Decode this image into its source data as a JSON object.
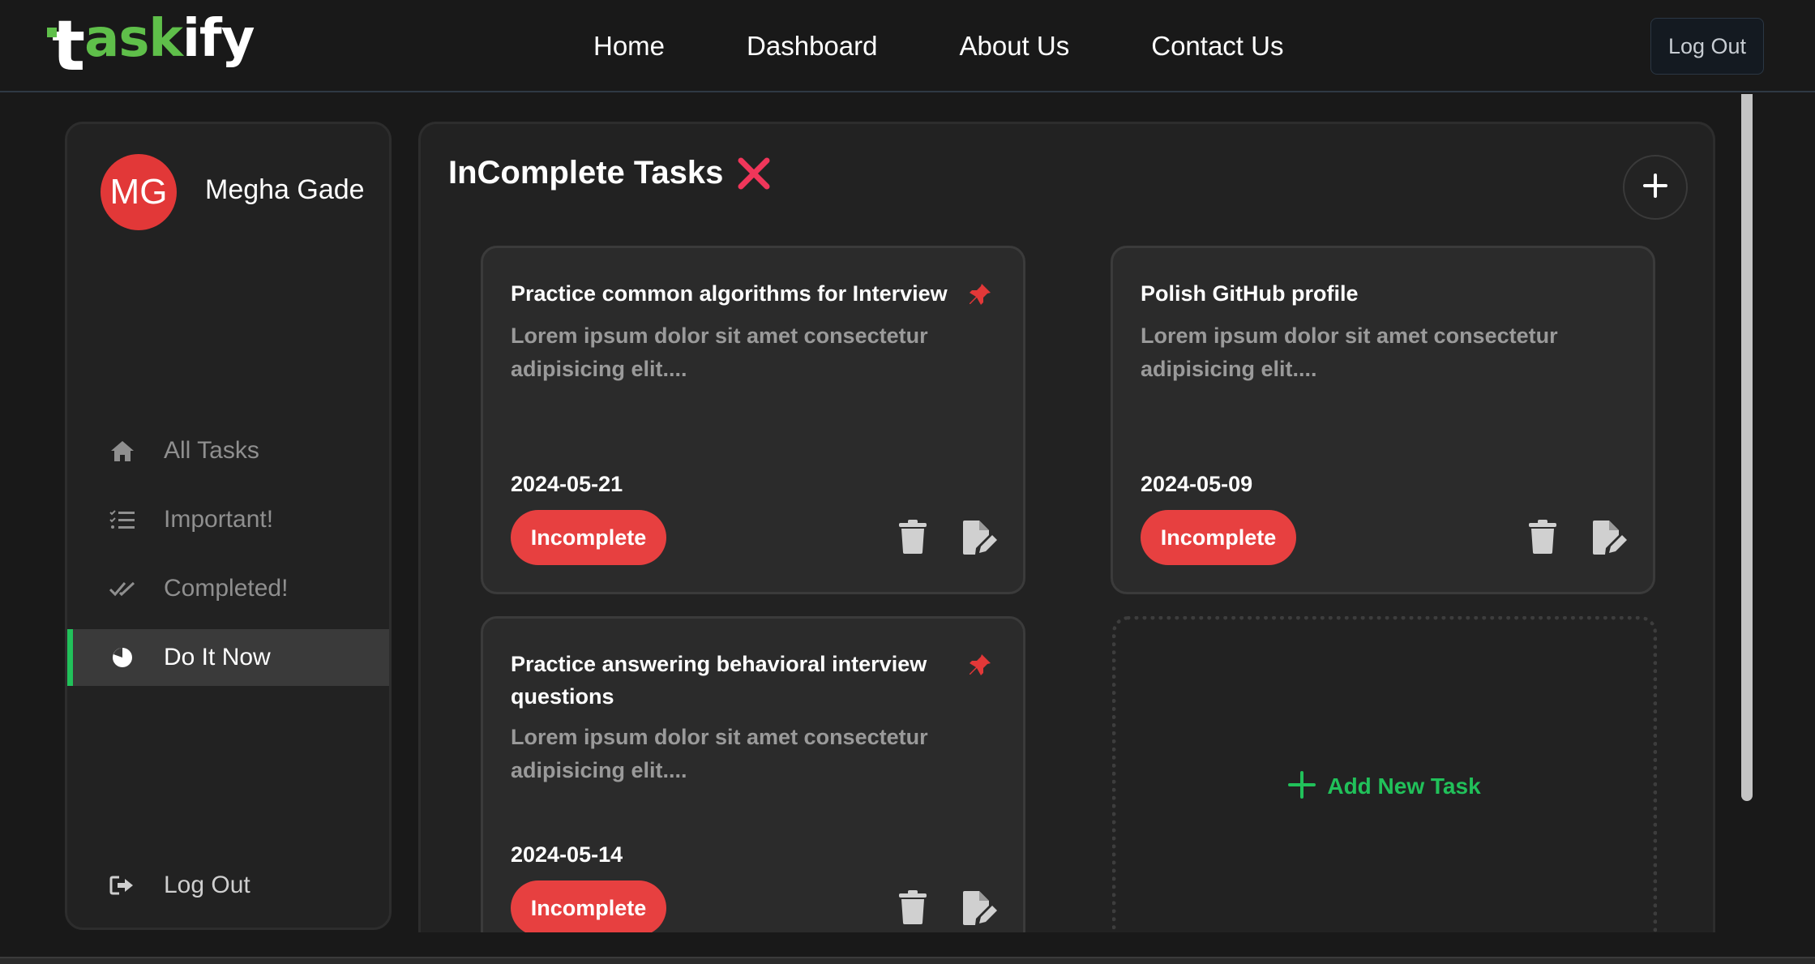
{
  "brand": {
    "logo_t": "t",
    "logo_ask": "ask",
    "logo_ify": "ify",
    "accent": "#5fbf4a"
  },
  "nav": {
    "links": [
      "Home",
      "Dashboard",
      "About Us",
      "Contact Us"
    ],
    "logout_label": "Log Out"
  },
  "sidebar": {
    "avatar_initials": "MG",
    "avatar_color": "#e23838",
    "user_name": "Megha Gade",
    "items": [
      {
        "label": "All Tasks",
        "icon": "home-icon"
      },
      {
        "label": "Important!",
        "icon": "list-check-icon"
      },
      {
        "label": "Completed!",
        "icon": "double-check-icon"
      },
      {
        "label": "Do It Now",
        "icon": "pie-chart-icon",
        "active": true
      }
    ],
    "logout_label": "Log Out",
    "active_color": "#21c15a"
  },
  "main": {
    "title": "InComplete Tasks",
    "title_icon": "x-icon",
    "add_button_icon": "plus-icon"
  },
  "tasks": [
    {
      "title": "Practice common algorithms for Interview",
      "description": "Lorem ipsum dolor sit amet consectetur adipisicing elit....",
      "date": "2024-05-21",
      "status": "Incomplete",
      "pinned": true
    },
    {
      "title": "Polish GitHub profile",
      "description": "Lorem ipsum dolor sit amet consectetur adipisicing elit....",
      "date": "2024-05-09",
      "status": "Incomplete",
      "pinned": false
    },
    {
      "title": "Practice answering behavioral interview questions",
      "description": "Lorem ipsum dolor sit amet consectetur adipisicing elit....",
      "date": "2024-05-14",
      "status": "Incomplete",
      "pinned": true
    }
  ],
  "add_task": {
    "label": "Add New Task",
    "color": "#21c15a"
  },
  "status_color": "#e74040"
}
